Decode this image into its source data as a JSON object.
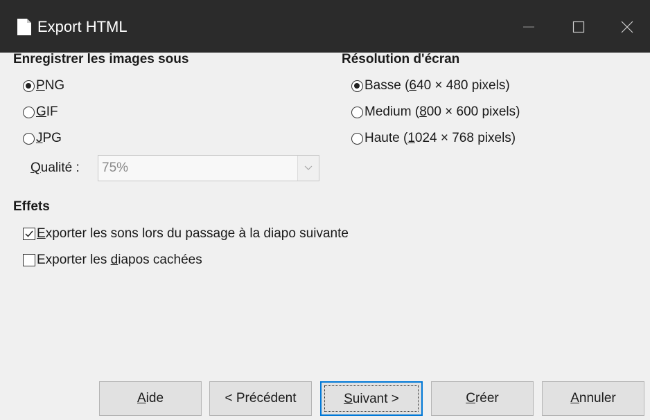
{
  "window": {
    "title": "Export HTML",
    "icon": "document-icon",
    "controls": [
      "minimize-icon",
      "maximize-icon",
      "close-icon"
    ]
  },
  "images_section": {
    "title": "Enregistrer les images sous",
    "options": [
      {
        "pre": "",
        "key": "P",
        "post": "NG",
        "selected": true
      },
      {
        "pre": "",
        "key": "G",
        "post": "IF",
        "selected": false
      },
      {
        "pre": "",
        "key": "J",
        "post": "PG",
        "selected": false
      }
    ],
    "quality": {
      "pre": "",
      "key": "Q",
      "post": "ualité :",
      "value": "75%",
      "enabled": false
    }
  },
  "resolution_section": {
    "title": "Résolution d'écran",
    "options": [
      {
        "pre": "Basse (",
        "key": "6",
        "post": "40 × 480 pixels)",
        "selected": true
      },
      {
        "pre": "Medium (",
        "key": "8",
        "post": "00 × 600 pixels)",
        "selected": false
      },
      {
        "pre": "Haute (",
        "key": "1",
        "post": "024 × 768 pixels)",
        "selected": false
      }
    ]
  },
  "effects_section": {
    "title": "Effets",
    "options": [
      {
        "pre": "",
        "key": "E",
        "post": "xporter les sons lors du passage à la diapo suivante",
        "checked": true
      },
      {
        "pre": "Exporter les ",
        "key": "d",
        "post": "iapos cachées",
        "checked": false
      }
    ]
  },
  "buttons": {
    "help": {
      "pre": "",
      "key": "A",
      "post": "ide"
    },
    "previous": {
      "label": "< Précédent"
    },
    "next": {
      "pre": "",
      "key": "S",
      "post": "uivant >"
    },
    "create": {
      "pre": "",
      "key": "C",
      "post": "réer"
    },
    "cancel": {
      "pre": "",
      "key": "A",
      "post": "nnuler"
    }
  },
  "colors": {
    "titlebar": "#2b2b2b",
    "dialog_bg": "#f0f0f0",
    "button_bg": "#e1e1e1",
    "default_button_border": "#0078d7",
    "disabled_text": "#8a8a8a"
  }
}
